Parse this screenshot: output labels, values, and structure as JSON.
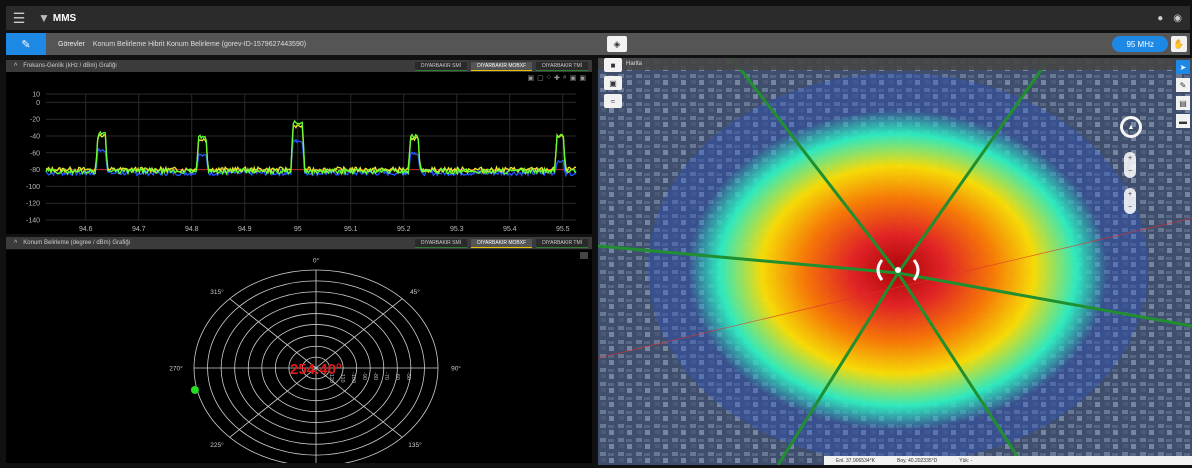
{
  "app": {
    "title": "MMS"
  },
  "task": {
    "label": "Görevler",
    "text": "Konum Belirleme Hibrit Konum Belirleme (gorev-ID-1579627443590)"
  },
  "frequency_pill": "95 MHz",
  "panels": {
    "spectrum": {
      "title": "Frekans-Genlik (kHz / dBm) Grafiği",
      "tabs": [
        "DIYARBAKIR SMİ",
        "DIYARBAKIR MOBXF",
        "DIYARBAKIR TMİ"
      ],
      "active_tab": 1
    },
    "direction": {
      "title": "Konum Belirleme (degree / dBm) Grafiği",
      "tabs": [
        "DIYARBAKIR SMİ",
        "DIYARBAKIR MOBXF",
        "DIYARBAKIR TMİ"
      ],
      "active_tab": 1,
      "bearing": "254.40°"
    }
  },
  "map": {
    "header": "Harita",
    "status": {
      "lat": "Enl. 37.906534°K",
      "lon": "Boy. 40.202335°D",
      "alt": "Yük: -"
    }
  },
  "chart_data": [
    {
      "type": "line",
      "ylim": [
        -140,
        10
      ],
      "yticks": [
        10,
        0,
        -20,
        -40,
        -60,
        -80,
        -100,
        -120,
        -140
      ],
      "xlim": [
        94.525,
        95.525
      ],
      "xticks": [
        "94.6",
        "94.7",
        "94.8",
        "94.9",
        "95",
        "95.1",
        "95.2",
        "95.3",
        "95.4",
        "95.5"
      ],
      "threshold": -80,
      "baseline_levels": {
        "yellow": -80,
        "green": -82,
        "blue": -84
      },
      "peaks": [
        {
          "center": 94.63,
          "width": 0.022,
          "green": -37,
          "yellow": -39,
          "blue": -57
        },
        {
          "center": 94.82,
          "width": 0.022,
          "green": -41,
          "yellow": -44,
          "blue": -62
        },
        {
          "center": 95.0,
          "width": 0.026,
          "green": -24,
          "yellow": -29,
          "blue": -46
        },
        {
          "center": 95.22,
          "width": 0.022,
          "green": -40,
          "yellow": -43,
          "blue": -60
        },
        {
          "center": 95.495,
          "width": 0.02,
          "green": -40,
          "yellow": -40,
          "blue": -70
        }
      ]
    },
    {
      "type": "polar",
      "angle_labels": [
        "0°",
        "45°",
        "90°",
        "135°",
        "225°",
        "270°",
        "315°"
      ],
      "radial_labels": [
        "-120",
        "-110",
        "-100",
        "-90",
        "-80",
        "-70",
        "-60",
        "-50"
      ],
      "bearing_deg": 254.4,
      "marker_angle_deg": 263
    }
  ],
  "colors": {
    "accent": "#1e88e5",
    "series_green": "#66ff33",
    "series_yellow": "#e6e62e",
    "series_blue": "#2255ff",
    "threshold": "#cc2222",
    "bearing": "#e01919"
  }
}
